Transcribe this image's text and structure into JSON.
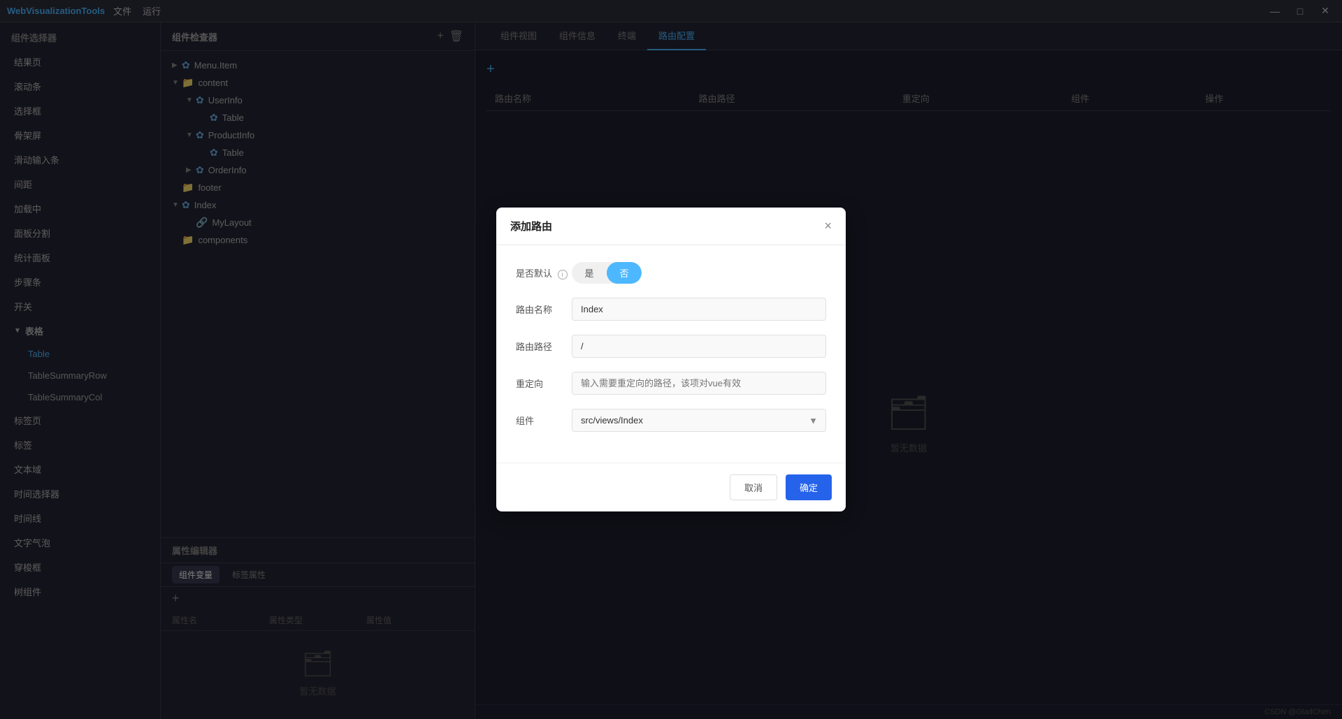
{
  "app": {
    "title": "WebVisualizationTools",
    "menu": [
      "文件",
      "运行"
    ],
    "controls": [
      "—",
      "□",
      "✕"
    ]
  },
  "sidebar": {
    "header": "组件选择器",
    "items": [
      {
        "label": "结果页",
        "active": false
      },
      {
        "label": "滚动条",
        "active": false
      },
      {
        "label": "选择框",
        "active": false
      },
      {
        "label": "骨架屏",
        "active": false
      },
      {
        "label": "滑动输入条",
        "active": false
      },
      {
        "label": "间距",
        "active": false
      },
      {
        "label": "加载中",
        "active": false
      },
      {
        "label": "面板分割",
        "active": false
      },
      {
        "label": "统计面板",
        "active": false
      },
      {
        "label": "步骤条",
        "active": false
      },
      {
        "label": "开关",
        "active": false
      },
      {
        "label": "表格",
        "active": true,
        "expanded": true
      },
      {
        "label": "Table",
        "active": true,
        "sub": true
      },
      {
        "label": "TableSummaryRow",
        "active": false,
        "sub": true
      },
      {
        "label": "TableSummaryCol",
        "active": false,
        "sub": true
      },
      {
        "label": "标签页",
        "active": false
      },
      {
        "label": "标签",
        "active": false
      },
      {
        "label": "文本域",
        "active": false
      },
      {
        "label": "时间选择器",
        "active": false
      },
      {
        "label": "时间线",
        "active": false
      },
      {
        "label": "文字气泡",
        "active": false
      },
      {
        "label": "穿梭框",
        "active": false
      },
      {
        "label": "树组件",
        "active": false
      }
    ]
  },
  "inspector": {
    "header": "组件检查器",
    "add_btn": "+",
    "del_btn": "🗑",
    "tree": [
      {
        "indent": 0,
        "arrow": "▶",
        "icon": "component",
        "label": "Menu.Item"
      },
      {
        "indent": 0,
        "arrow": "▼",
        "icon": "folder",
        "label": "content"
      },
      {
        "indent": 1,
        "arrow": "▼",
        "icon": "component",
        "label": "UserInfo"
      },
      {
        "indent": 2,
        "arrow": "",
        "icon": "table-ic",
        "label": "Table"
      },
      {
        "indent": 1,
        "arrow": "▼",
        "icon": "component",
        "label": "ProductInfo"
      },
      {
        "indent": 2,
        "arrow": "",
        "icon": "table-ic",
        "label": "Table"
      },
      {
        "indent": 1,
        "arrow": "▶",
        "icon": "component",
        "label": "OrderInfo"
      },
      {
        "indent": 0,
        "arrow": "",
        "icon": "folder",
        "label": "footer"
      },
      {
        "indent": 0,
        "arrow": "▼",
        "icon": "component",
        "label": "Index"
      },
      {
        "indent": 1,
        "arrow": "",
        "icon": "link",
        "label": "MyLayout"
      },
      {
        "indent": 0,
        "arrow": "",
        "icon": "folder",
        "label": "components"
      }
    ]
  },
  "prop_editor": {
    "header": "属性编辑器",
    "tabs": [
      "组件变量",
      "标签属性"
    ],
    "active_tab": "组件变量",
    "add_btn": "+",
    "columns": [
      "属性名",
      "属性类型",
      "属性值"
    ],
    "empty_text": "暂无数据"
  },
  "content": {
    "tabs": [
      "组件视图",
      "组件信息",
      "终端",
      "路由配置"
    ],
    "active_tab": "路由配置",
    "route_add_btn": "+",
    "route_columns": [
      "路由名称",
      "路由路径",
      "重定向",
      "组件",
      "操作"
    ],
    "empty_text": "暂无数据"
  },
  "dialog": {
    "title": "添加路由",
    "close_btn": "×",
    "fields": [
      {
        "key": "is_default",
        "label": "是否默认",
        "type": "toggle",
        "info": true,
        "options": [
          "是",
          "否"
        ],
        "active": "否"
      },
      {
        "key": "route_name",
        "label": "路由名称",
        "type": "input",
        "value": "Index",
        "placeholder": ""
      },
      {
        "key": "route_path",
        "label": "路由路径",
        "type": "input",
        "value": "/",
        "placeholder": ""
      },
      {
        "key": "redirect",
        "label": "重定向",
        "type": "input",
        "value": "",
        "placeholder": "输入需要重定向的路径，该项对vue有效"
      },
      {
        "key": "component",
        "label": "组件",
        "type": "select",
        "value": "src/views/Index",
        "options": [
          "src/views/Index"
        ]
      }
    ],
    "cancel_btn": "取消",
    "confirm_btn": "确定"
  },
  "footer": {
    "credit": "CSDN @GladChen"
  }
}
